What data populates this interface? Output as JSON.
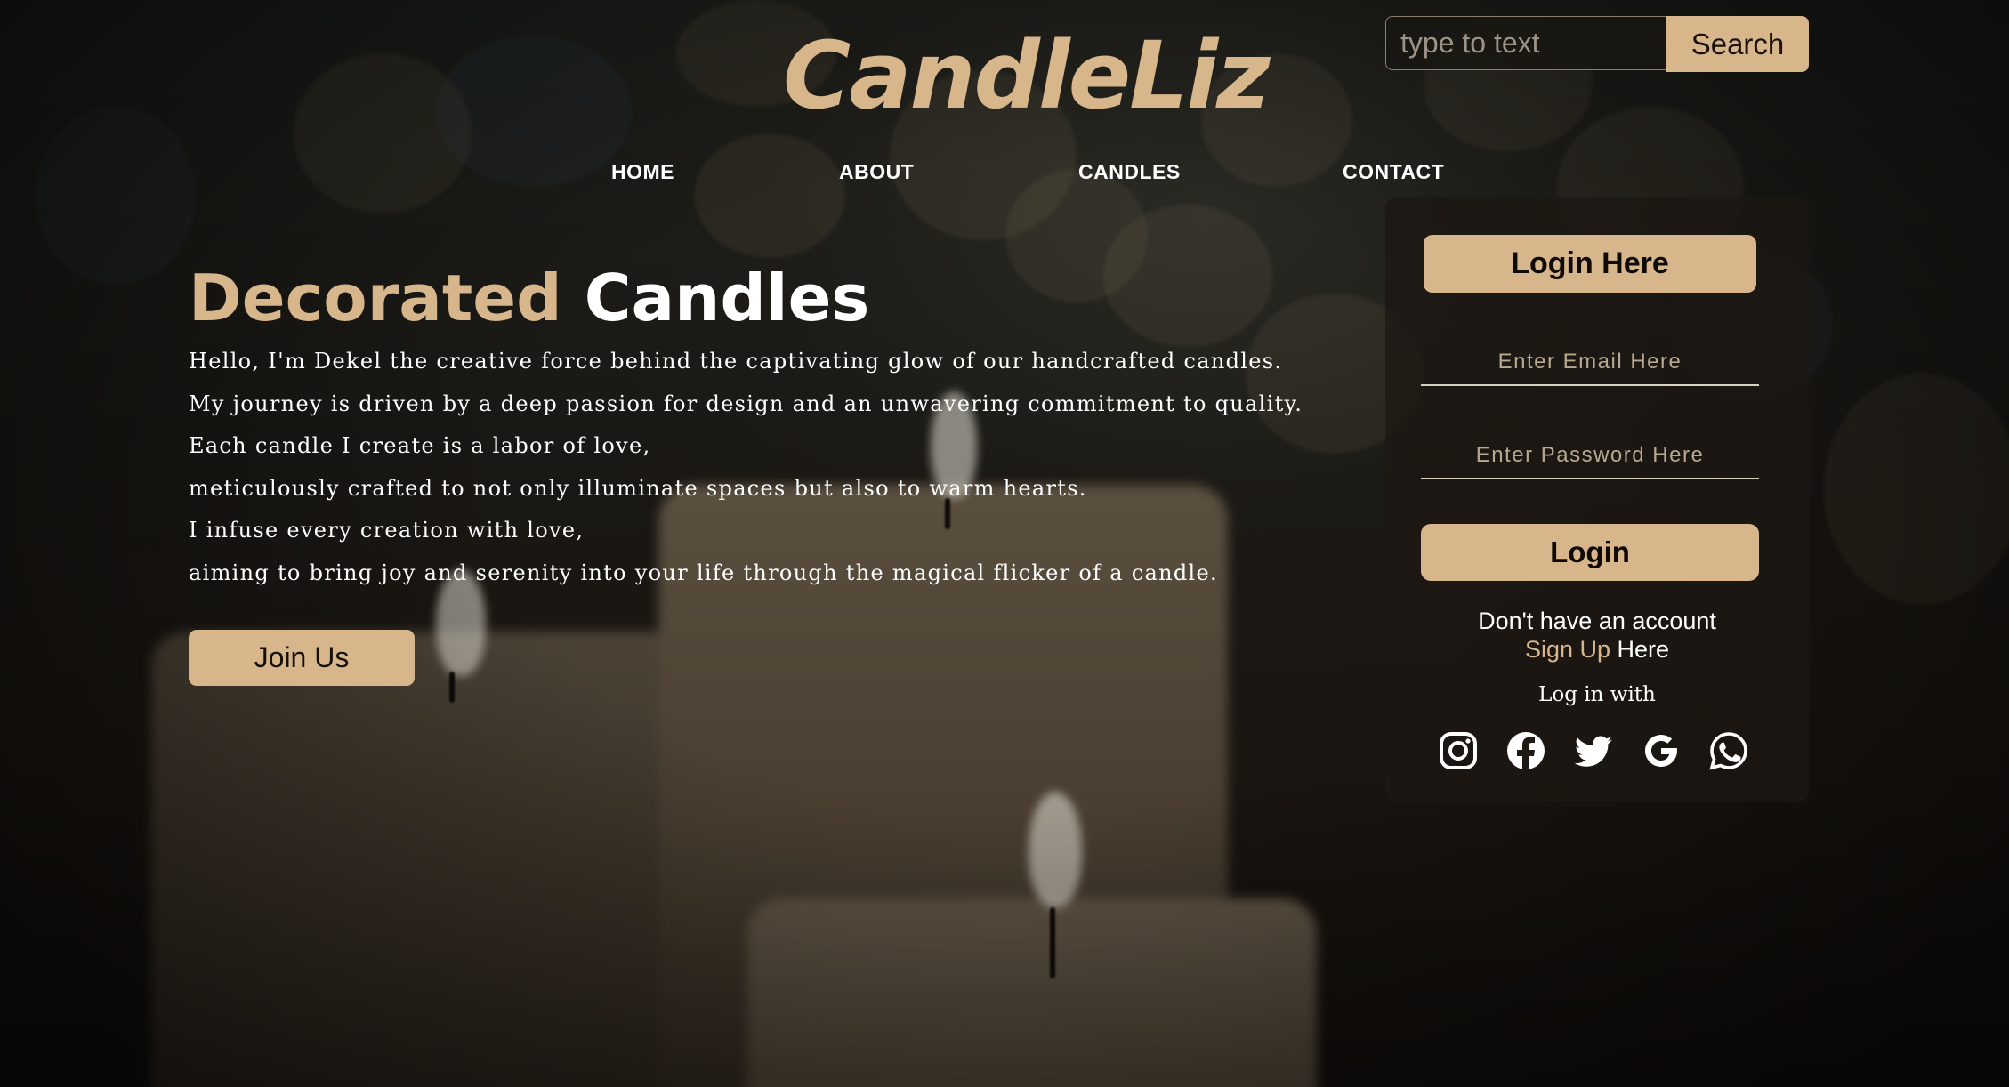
{
  "site": {
    "logo": "CandleLiz"
  },
  "search": {
    "placeholder": "type to text",
    "button_label": "Search"
  },
  "nav": {
    "items": [
      "HOME",
      "ABOUT",
      "CANDLES",
      "CONTACT"
    ]
  },
  "hero": {
    "title_word1": "Decorated",
    "title_word2": "Candles",
    "paragraphs": [
      "Hello, I'm Dekel the creative force behind the captivating glow of our handcrafted candles.",
      "My journey is driven by a deep passion for design and an unwavering commitment to quality.",
      "Each candle I create is a labor of love,",
      "meticulously crafted to not only illuminate spaces but also to warm hearts.",
      "I infuse every creation with love,",
      "aiming to bring joy and serenity into your life through the magical flicker of a candle."
    ],
    "join_label": "Join Us"
  },
  "login": {
    "header_label": "Login Here",
    "email_placeholder": "Enter Email Here",
    "password_placeholder": "Enter Password Here",
    "login_label": "Login",
    "no_account_text": "Don't have an account",
    "signup_link": "Sign Up",
    "signup_suffix": " Here",
    "log_in_with": "Log in with",
    "social_icons": [
      "instagram-icon",
      "facebook-icon",
      "twitter-icon",
      "google-icon",
      "whatsapp-icon"
    ]
  },
  "colors": {
    "accent": "#d8b68c",
    "background": "#17130f",
    "text": "#ffffff"
  }
}
